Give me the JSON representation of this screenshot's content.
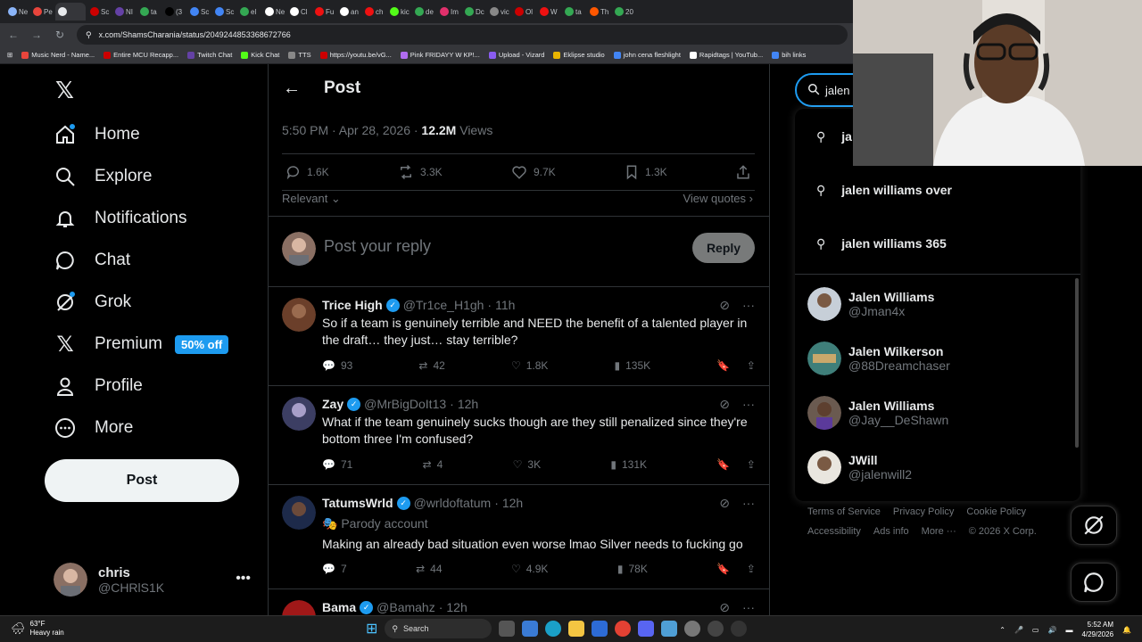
{
  "browser": {
    "tabs": [
      "Ne",
      "Pe",
      "",
      "Sc",
      "NI",
      "ta",
      "(3",
      "Sc",
      "Sc",
      "el",
      "Ne",
      "Cl",
      "Fu",
      "an",
      "ch",
      "kic",
      "de",
      "Im",
      "Dc",
      "vic",
      "Ol",
      "W",
      "ta",
      "Th",
      "20"
    ],
    "url": "x.com/ShamsCharania/status/2049244853368672766",
    "bookmarks": [
      "Music Nerd - Name...",
      "Entire MCU Recapp...",
      "Twitch Chat",
      "Kick Chat",
      "TTS",
      "https://youtu.be/vG...",
      "Pink FRIDAYY W KP!...",
      "Upload - Vizard",
      "Eklipse studio",
      "john cena fleshlight",
      "Rapidtags | YouTub...",
      "bih links"
    ]
  },
  "nav": {
    "items": [
      {
        "label": "Home",
        "icon": "home-icon"
      },
      {
        "label": "Explore",
        "icon": "search-icon"
      },
      {
        "label": "Notifications",
        "icon": "bell-icon"
      },
      {
        "label": "Chat",
        "icon": "chat-icon"
      },
      {
        "label": "Grok",
        "icon": "grok-icon"
      },
      {
        "label": "Premium",
        "icon": "x-logo-icon"
      },
      {
        "label": "Profile",
        "icon": "person-icon"
      },
      {
        "label": "More",
        "icon": "more-circle-icon"
      }
    ],
    "premium_badge": "50% off",
    "post_button": "Post",
    "account": {
      "name": "chris",
      "handle": "@CHRlS1K"
    }
  },
  "post": {
    "header_title": "Post",
    "timestamp": "5:50 PM · Apr 28, 2026 · ",
    "views_count": "12.2M",
    "views_label": " Views",
    "stats": {
      "replies": "1.6K",
      "reposts": "3.3K",
      "likes": "9.7K",
      "bookmarks": "1.3K"
    },
    "sort": "Relevant",
    "view_quotes": "View quotes",
    "reply_placeholder": "Post your reply",
    "reply_button": "Reply"
  },
  "replies": [
    {
      "name": "Trice High",
      "handle": "@Tr1ce_H1gh",
      "time": "11h",
      "text": "So if a team is genuinely terrible and NEED the benefit of a talented player in the draft… they just… stay terrible?",
      "replies": "93",
      "reposts": "42",
      "likes": "1.8K",
      "views": "135K"
    },
    {
      "name": "Zay",
      "handle": "@MrBigDoIt13",
      "time": "12h",
      "text": "What if the team genuinely sucks though are they still penalized since they're bottom three I'm confused?",
      "replies": "71",
      "reposts": "4",
      "likes": "3K",
      "views": "131K"
    },
    {
      "name": "TatumsWrld",
      "handle": "@wrldoftatum",
      "time": "12h",
      "label": "Parody account",
      "text": "Making an already bad situation even worse lmao Silver needs to fucking go",
      "replies": "7",
      "reposts": "44",
      "likes": "4.9K",
      "views": "78K"
    },
    {
      "name": "Bama",
      "handle": "@Bamahz",
      "time": "12h"
    }
  ],
  "search": {
    "query": "jalen w",
    "suggestions": [
      "ja",
      "jalen williams over",
      "jalen williams 365"
    ],
    "users": [
      {
        "name": "Jalen Williams",
        "handle": "@Jman4x"
      },
      {
        "name": "Jalen Wilkerson",
        "handle": "@88Dreamchaser"
      },
      {
        "name": "Jalen Williams",
        "handle": "@Jay__DeShawn"
      },
      {
        "name": "JWill",
        "handle": "@jalenwill2"
      }
    ]
  },
  "footer": {
    "links": [
      "Terms of Service",
      "Privacy Policy",
      "Cookie Policy",
      "Accessibility",
      "Ads info",
      "More ···"
    ],
    "copyright": "© 2026 X Corp."
  },
  "taskbar": {
    "temp": "63°F",
    "weather": "Heavy rain",
    "search_label": "Search",
    "time": "5:52 AM",
    "date": "4/29/2026"
  },
  "colors": {
    "accent": "#1d9bf0",
    "text": "#e7e9ea",
    "muted": "#71767b",
    "border": "#2f3336"
  }
}
